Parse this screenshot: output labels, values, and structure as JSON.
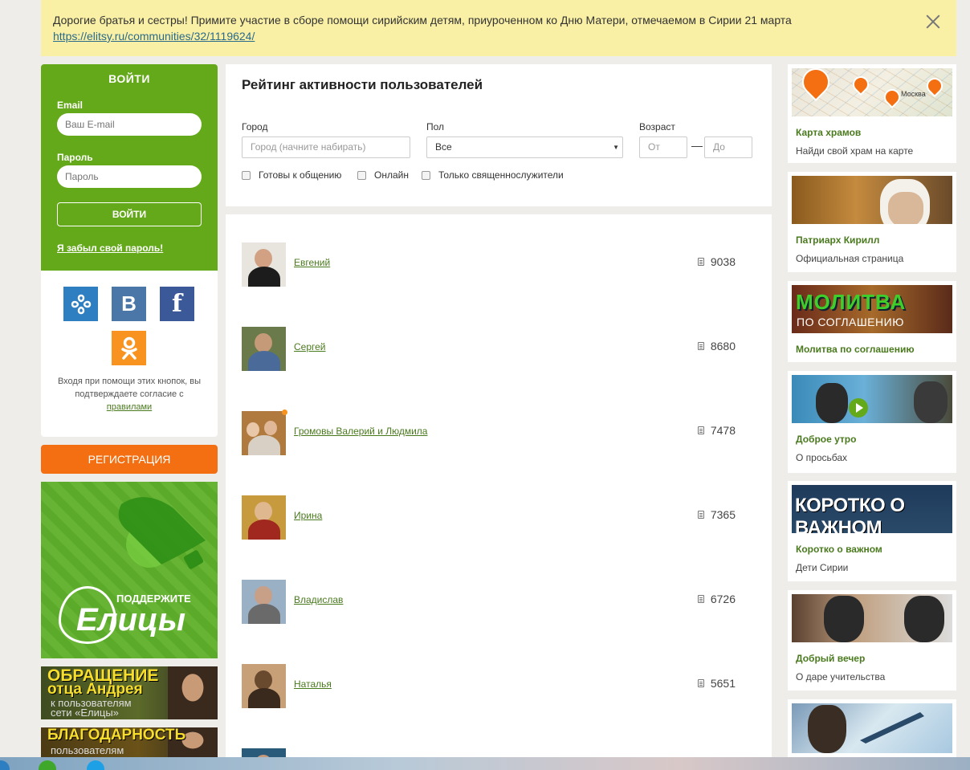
{
  "banner": {
    "text": "Дорогие братья и сестры! Примите участие в сборе помощи сирийским детям, приуроченном ко Дню Матери, отмечаемом в Сирии 21 марта",
    "link": "https://elitsy.ru/communities/32/1119624/"
  },
  "login": {
    "title": "ВОЙТИ",
    "email_label": "Email",
    "email_placeholder": "Ваш E-mail",
    "password_label": "Пароль",
    "password_placeholder": "Пароль",
    "submit_label": "ВОЙТИ",
    "forgot_label": "Я забыл свой пароль!"
  },
  "social": {
    "vk_letter": "B",
    "fb_letter": "f",
    "note": "Входя при помощи этих кнопок, вы подтверждаете согласие с",
    "rules_link": "правилами"
  },
  "register_label": "РЕГИСТРАЦИЯ",
  "support": {
    "small": "ПОДДЕРЖИТЕ",
    "big": "Елицы"
  },
  "promos": {
    "appeal": {
      "line1": "ОБРАЩЕНИЕ",
      "line2": "отца Андрея",
      "line3": "к пользователям",
      "line4": "сети «Елицы»"
    },
    "thanks": {
      "line1": "БЛАГОДАРНОСТЬ",
      "line2": "пользователям"
    }
  },
  "filter": {
    "title": "Рейтинг активности пользователей",
    "city_label": "Город",
    "city_placeholder": "Город (начните набирать)",
    "gender_label": "Пол",
    "gender_value": "Все",
    "age_label": "Возраст",
    "age_from_placeholder": "От",
    "age_to_placeholder": "До",
    "dash": "—",
    "check_ready": "Готовы к общению",
    "check_online": "Онлайн",
    "check_clergy": "Только священнослужители"
  },
  "users": [
    {
      "name": "Евгений",
      "score": "9038"
    },
    {
      "name": "Сергей",
      "score": "8680"
    },
    {
      "name": "Громовы Валерий и Людмила",
      "score": "7478"
    },
    {
      "name": "Ирина",
      "score": "7365"
    },
    {
      "name": "Владислав",
      "score": "6726"
    },
    {
      "name": "Наталья",
      "score": "5651"
    }
  ],
  "cards": [
    {
      "title": "Карта храмов",
      "sub": "Найди свой храм на карте",
      "map_label": "Москва"
    },
    {
      "title": "Патриарх Кирилл",
      "sub": "Официальная страница"
    },
    {
      "title": "Молитва по соглашению",
      "img_line1": "МОЛИТВА",
      "img_line2": "ПО СОГЛАШЕНИЮ"
    },
    {
      "title": "Доброе утро",
      "sub": "О просьбах"
    },
    {
      "title": "Коротко о важном",
      "sub": "Дети Сирии",
      "img_text": "КОРОТКО О ВАЖНОМ"
    },
    {
      "title": "Добрый вечер",
      "sub": "О даре учительства"
    }
  ],
  "colors": {
    "brand_green": "#64a91a",
    "accent_orange": "#f36f12",
    "banner_yellow": "#f9f0a6",
    "link_green": "#4a7a1e"
  }
}
